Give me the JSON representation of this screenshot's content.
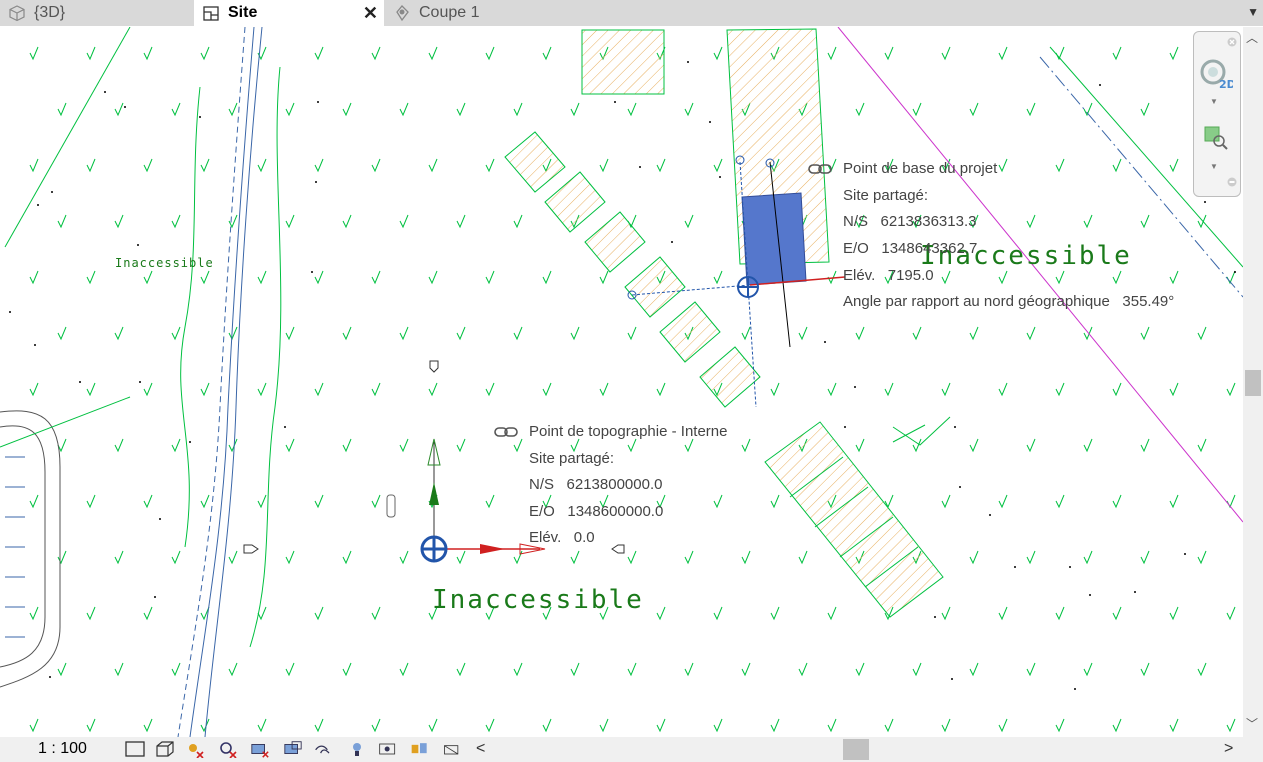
{
  "tabs": [
    {
      "label": "{3D}",
      "icon": "cube-icon",
      "active": false
    },
    {
      "label": "Site",
      "icon": "floorplan-icon",
      "active": true
    },
    {
      "label": "Coupe 1",
      "icon": "section-icon",
      "active": false
    }
  ],
  "project_base_point": {
    "title": "Point de base du projet",
    "site": "Site partagé:",
    "ns_label": "N/S",
    "ns_value": "6213836313.3",
    "eo_label": "E/O",
    "eo_value": "1348643362.7",
    "elev_label": "Elév.",
    "elev_value": "7195.0",
    "angle_label": "Angle par rapport au nord géographique",
    "angle_value": "355.49°"
  },
  "survey_point": {
    "title": "Point de topographie - Interne",
    "site": "Site partagé:",
    "ns_label": "N/S",
    "ns_value": "6213800000.0",
    "eo_label": "E/O",
    "eo_value": "1348600000.0",
    "elev_label": "Elév.",
    "elev_value": "0.0"
  },
  "inaccessible_labels": [
    "Inaccessible",
    "Inaccessible",
    "Inaccessible"
  ],
  "status": {
    "scale": "1 : 100"
  },
  "colors": {
    "accent_blue": "#5577cc",
    "grass_green": "#00c040",
    "boundary_magenta": "#cc33cc",
    "hatch_orange": "#e8b060"
  }
}
